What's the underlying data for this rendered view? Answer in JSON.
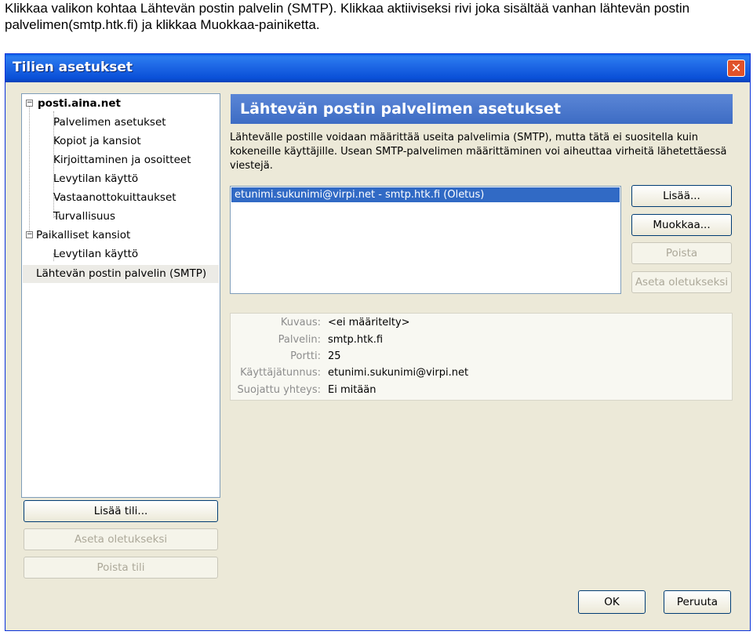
{
  "instruction": "Klikkaa valikon kohtaa Lähtevän postin palvelin (SMTP). Klikkaa aktiiviseksi rivi joka sisältää vanhan lähtevän postin palvelimen(smtp.htk.fi) ja klikkaa Muokkaa-painiketta.",
  "window": {
    "title": "Tilien asetukset",
    "close_glyph": "✕"
  },
  "tree": {
    "account": "posti.aina.net",
    "account_items": [
      "Palvelimen asetukset",
      "Kopiot ja kansiot",
      "Kirjoittaminen ja osoitteet",
      "Levytilan käyttö",
      "Vastaanottokuittaukset",
      "Turvallisuus"
    ],
    "local": "Paikalliset kansiot",
    "local_items": [
      "Levytilan käyttö"
    ],
    "smtp": "Lähtevän postin palvelin (SMTP)",
    "expander": "−"
  },
  "left_buttons": {
    "add_account": "Lisää tili...",
    "set_default": "Aseta oletukseksi",
    "remove_account": "Poista tili"
  },
  "panel": {
    "header": "Lähtevän postin palvelimen asetukset",
    "description": "Lähtevälle postille voidaan määrittää useita palvelimia (SMTP), mutta tätä ei suositella kuin kokeneille käyttäjille. Usean SMTP-palvelimen määrittäminen voi aiheuttaa virheitä lähetettäessä viestejä.",
    "servers": [
      "etunimi.sukunimi@virpi.net - smtp.htk.fi (Oletus)"
    ],
    "buttons": {
      "add": "Lisää...",
      "edit": "Muokkaa...",
      "remove": "Poista",
      "set_default": "Aseta oletukseksi"
    },
    "details": {
      "description_label": "Kuvaus:",
      "description_value": "<ei määritelty>",
      "server_label": "Palvelin:",
      "server_value": "smtp.htk.fi",
      "port_label": "Portti:",
      "port_value": "25",
      "username_label": "Käyttäjätunnus:",
      "username_value": "etunimi.sukunimi@virpi.net",
      "security_label": "Suojattu yhteys:",
      "security_value": "Ei mitään"
    }
  },
  "footer": {
    "ok": "OK",
    "cancel": "Peruuta"
  }
}
